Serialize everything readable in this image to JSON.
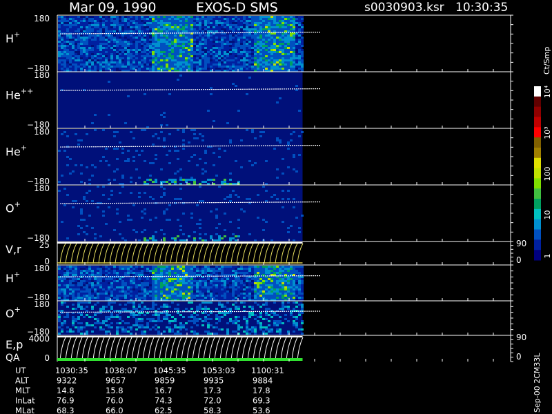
{
  "header": {
    "date": "Mar 09, 1990",
    "instrument": "EXOS-D SMS",
    "file": "s0030903.ksr",
    "time": "10:30:35"
  },
  "colorbar": {
    "unit": "Ct/Smp",
    "tick_labels": [
      "1",
      "10",
      "100",
      "10³",
      "10⁴"
    ],
    "colors": [
      "#000080",
      "#0020a0",
      "#0050c0",
      "#0090d0",
      "#00c0c0",
      "#00a060",
      "#40c040",
      "#80e000",
      "#c0e000",
      "#e0e000",
      "#a08000",
      "#806000",
      "#ff0000",
      "#c00000",
      "#900000",
      "#600000",
      "#ffffff"
    ]
  },
  "footer_note": "Sep-00 2CM33L",
  "chart_data": {
    "type": "heatmap",
    "panels": [
      {
        "label": "H",
        "superscript": "+",
        "ymax": "180",
        "ymin": "−180",
        "intensity": "high"
      },
      {
        "label": "He",
        "superscript": "++",
        "ymax": "180",
        "ymin": "−180",
        "intensity": "low"
      },
      {
        "label": "He",
        "superscript": "+",
        "ymax": "180",
        "ymin": "−180",
        "intensity": "low-events"
      },
      {
        "label": "O",
        "superscript": "+",
        "ymax": "180",
        "ymin": "−180",
        "intensity": "low-events"
      },
      {
        "label": "V,r",
        "superscript": "",
        "ymax": "25",
        "ymin": "0",
        "right_ymax": "90",
        "right_ymin": "0",
        "intensity": "line"
      },
      {
        "label": "H",
        "superscript": "+",
        "ymax": "180",
        "ymin": "−180",
        "intensity": "high"
      },
      {
        "label": "O",
        "superscript": "+",
        "ymax": "180",
        "ymin": "−180",
        "intensity": "medium"
      },
      {
        "label": "E,p",
        "label2": "QA",
        "superscript": "",
        "ymax": "4000",
        "ymin": "0",
        "right_ymax": "90",
        "right_ymin": "0",
        "intensity": "line"
      }
    ],
    "data_end_fraction": 0.5,
    "table": {
      "row_labels": [
        "UT",
        "ALT",
        "MLT",
        "InLat",
        "MLat"
      ],
      "columns": [
        [
          "1030:35",
          "9322",
          "14.8",
          "76.9",
          "68.3"
        ],
        [
          "1038:07",
          "9657",
          "15.8",
          "76.0",
          "66.0"
        ],
        [
          "1045:35",
          "9859",
          "16.7",
          "74.3",
          "62.5"
        ],
        [
          "1053:03",
          "9935",
          "17.3",
          "72.0",
          "58.3"
        ],
        [
          "1100:31",
          "9884",
          "17.8",
          "69.3",
          "53.6"
        ]
      ]
    }
  }
}
